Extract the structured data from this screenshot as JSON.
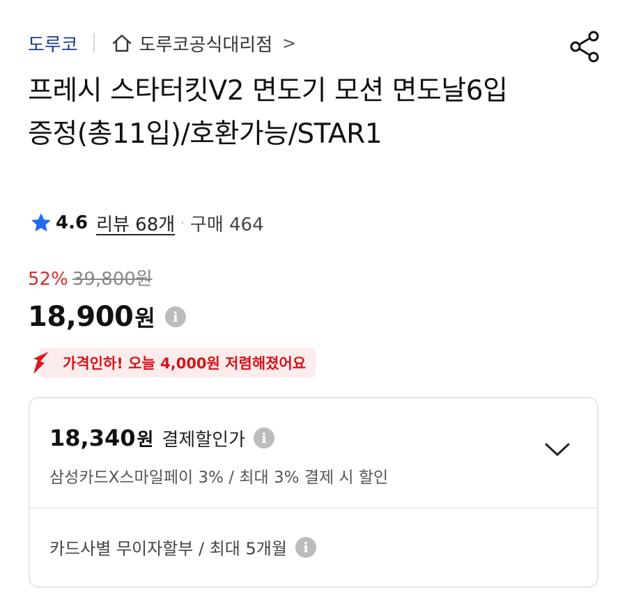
{
  "breadcrumb": {
    "brand": "도루코",
    "store": "도루코공식대리점",
    "chevron": ">"
  },
  "product": {
    "title": "프레시 스타터킷V2 면도기 모션 면도날6입증정(총11입)/호환가능/STAR1"
  },
  "rating": {
    "value": "4.6",
    "review_label": "리뷰 68개",
    "dot": "·",
    "purchase_label": "구매 464"
  },
  "pricing": {
    "discount": "52%",
    "original": "39,800원",
    "price": "18,900",
    "currency": "원",
    "info_glyph": "i",
    "drop_notice": "가격인하! 오늘 4,000원 저렴해졌어요"
  },
  "payment_card": {
    "discount_price": "18,340",
    "currency": "원",
    "label": "결제할인가",
    "condition": "삼성카드X스마일페이 3% / 최대 3% 결제 시 할인",
    "installment": "카드사별 무이자할부 / 최대 5개월"
  },
  "icons": {
    "home": "home-icon",
    "share": "share-icon",
    "star": "star-icon",
    "info": "info-icon",
    "chevron_down": "chevron-down-icon",
    "down_arrow": "down-arrow-icon"
  },
  "colors": {
    "brand": "#1a3a8f",
    "accent_red": "#d62b2b",
    "star_blue": "#1e6cf0",
    "banner_bg": "#fdecec"
  }
}
